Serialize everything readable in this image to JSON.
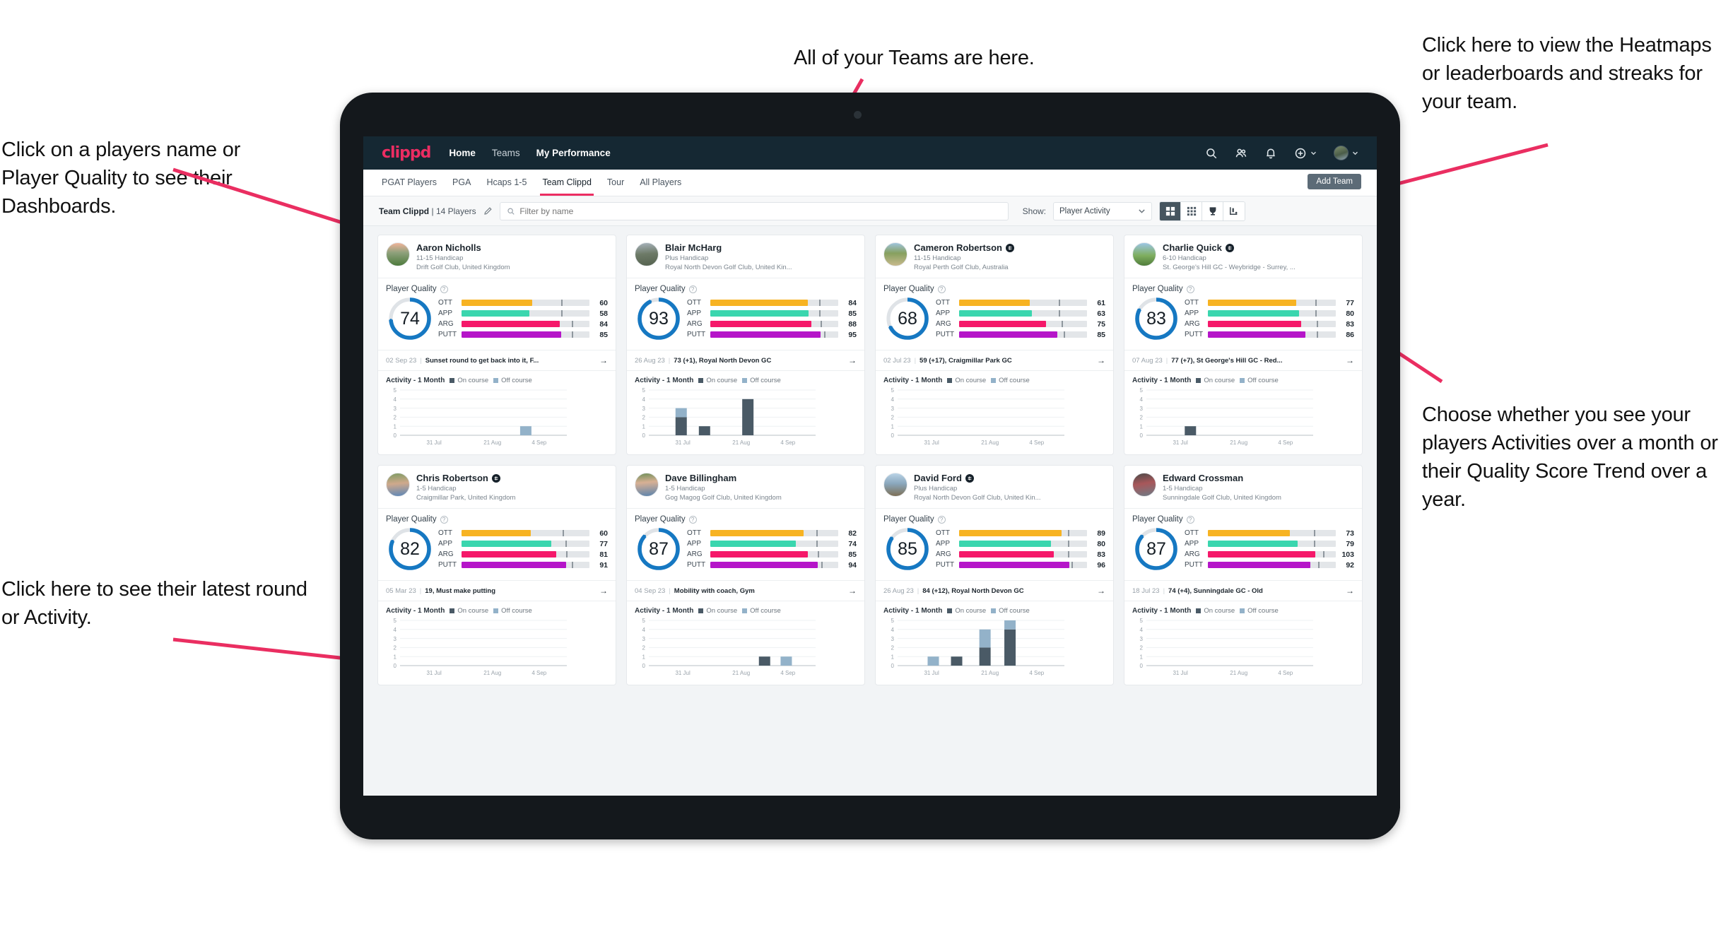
{
  "annotations": {
    "top": "All of your Teams are here.",
    "left_upper": "Click on a players name or Player Quality to see their Dashboards.",
    "left_lower": "Click here to see their latest round or Activity.",
    "right_upper": "Click here to view the Heatmaps or leaderboards and streaks for your team.",
    "right_lower": "Choose whether you see your players Activities over a month or their Quality Score Trend over a year.",
    "arrow_color": "#ea2e61"
  },
  "header": {
    "logo": "clippd",
    "nav": [
      {
        "label": "Home",
        "active": true
      },
      {
        "label": "Teams",
        "active": false
      },
      {
        "label": "My Performance",
        "active": true
      }
    ],
    "icons": [
      {
        "name": "search-icon"
      },
      {
        "name": "people-icon"
      },
      {
        "name": "bell-icon"
      },
      {
        "name": "plus-circle-icon"
      },
      {
        "name": "avatar-icon"
      }
    ],
    "bg": "#152833"
  },
  "subnav": {
    "tabs": [
      {
        "label": "PGAT Players",
        "active": false
      },
      {
        "label": "PGA",
        "active": false
      },
      {
        "label": "Hcaps 1-5",
        "active": false
      },
      {
        "label": "Team Clippd",
        "active": true
      },
      {
        "label": "Tour",
        "active": false
      },
      {
        "label": "All Players",
        "active": false
      }
    ],
    "add_team_label": "Add Team"
  },
  "toolbar": {
    "team_name": "Team Clippd",
    "team_count": "14 Players",
    "separator": "|",
    "edit_icon": "pencil-icon",
    "search_placeholder": "Filter by name",
    "search_value": "",
    "show_label": "Show:",
    "show_value": "Player Activity",
    "show_options": [
      "Player Activity",
      "Quality Score Trend"
    ],
    "views": [
      {
        "name": "grid-large-view-button",
        "icon": "grid-large-icon",
        "active": true
      },
      {
        "name": "grid-small-view-button",
        "icon": "grid-small-icon",
        "active": false
      },
      {
        "name": "leaderboard-view-button",
        "icon": "trophy-icon",
        "active": false
      },
      {
        "name": "heatmap-view-button",
        "icon": "heatmap-icon",
        "active": false
      }
    ]
  },
  "card_labels": {
    "player_quality": "Player Quality",
    "activity": "Activity - 1 Month",
    "legend_on": "On course",
    "legend_off": "Off course",
    "metrics": [
      "OTT",
      "APP",
      "ARG",
      "PUTT"
    ],
    "arrow": "→",
    "help": "?"
  },
  "metric_colors": {
    "OTT": "#f7b322",
    "APP": "#3ad6ae",
    "ARG": "#f5196a",
    "PUTT": "#b515c9",
    "track": "#e3e6e9",
    "ring": "#1678c2",
    "ring_bg": "#dfe3e7",
    "bar_on": "#4a5a66",
    "bar_off": "#93b2c9"
  },
  "players": [
    {
      "name": "Aaron Nicholls",
      "verified": false,
      "handicap": "11-15 Handicap",
      "club": "Drift Golf Club, United Kingdom",
      "quality": 74,
      "metrics": [
        {
          "label": "OTT",
          "value": 60,
          "fill": 55,
          "tick": 78
        },
        {
          "label": "APP",
          "value": 58,
          "fill": 53,
          "tick": 78
        },
        {
          "label": "ARG",
          "value": 84,
          "fill": 77,
          "tick": 86
        },
        {
          "label": "PUTT",
          "value": 85,
          "fill": 78,
          "tick": 86
        }
      ],
      "round": {
        "date": "02 Sep 23",
        "text": "Sunset round to get back into it, F..."
      },
      "chart_data": {
        "type": "bar",
        "ylim": [
          0,
          5
        ],
        "yticks": [
          0,
          1,
          2,
          3,
          4,
          5
        ],
        "xticks": [
          "31 Jul",
          "21 Aug",
          "4 Sep"
        ],
        "bars": [
          {
            "pos": 0.72,
            "on": 0,
            "off": 1
          }
        ]
      }
    },
    {
      "name": "Blair McHarg",
      "verified": false,
      "handicap": "Plus Handicap",
      "club": "Royal North Devon Golf Club, United Kin...",
      "quality": 93,
      "metrics": [
        {
          "label": "OTT",
          "value": 84,
          "fill": 76,
          "tick": 85
        },
        {
          "label": "APP",
          "value": 85,
          "fill": 77,
          "tick": 85
        },
        {
          "label": "ARG",
          "value": 88,
          "fill": 79,
          "tick": 86
        },
        {
          "label": "PUTT",
          "value": 95,
          "fill": 86,
          "tick": 89
        }
      ],
      "round": {
        "date": "26 Aug 23",
        "text": "73 (+1), Royal North Devon GC"
      },
      "chart_data": {
        "type": "bar",
        "ylim": [
          0,
          5
        ],
        "yticks": [
          0,
          1,
          2,
          3,
          4,
          5
        ],
        "xticks": [
          "31 Jul",
          "21 Aug",
          "4 Sep"
        ],
        "bars": [
          {
            "pos": 0.16,
            "on": 2,
            "off": 1
          },
          {
            "pos": 0.3,
            "on": 1,
            "off": 0
          },
          {
            "pos": 0.56,
            "on": 4,
            "off": 0
          }
        ]
      }
    },
    {
      "name": "Cameron Robertson",
      "verified": true,
      "handicap": "11-15 Handicap",
      "club": "Royal Perth Golf Club, Australia",
      "quality": 68,
      "metrics": [
        {
          "label": "OTT",
          "value": 61,
          "fill": 55,
          "tick": 78
        },
        {
          "label": "APP",
          "value": 63,
          "fill": 57,
          "tick": 78
        },
        {
          "label": "ARG",
          "value": 75,
          "fill": 68,
          "tick": 80
        },
        {
          "label": "PUTT",
          "value": 85,
          "fill": 77,
          "tick": 82
        }
      ],
      "round": {
        "date": "02 Jul 23",
        "text": "59 (+17), Craigmillar Park GC"
      },
      "chart_data": {
        "type": "bar",
        "ylim": [
          0,
          5
        ],
        "yticks": [
          0,
          1,
          2,
          3,
          4,
          5
        ],
        "xticks": [
          "31 Jul",
          "21 Aug",
          "4 Sep"
        ],
        "bars": []
      }
    },
    {
      "name": "Charlie Quick",
      "verified": true,
      "handicap": "6-10 Handicap",
      "club": "St. George's Hill GC - Weybridge - Surrey, ...",
      "quality": 83,
      "metrics": [
        {
          "label": "OTT",
          "value": 77,
          "fill": 69,
          "tick": 84
        },
        {
          "label": "APP",
          "value": 80,
          "fill": 71,
          "tick": 84
        },
        {
          "label": "ARG",
          "value": 83,
          "fill": 73,
          "tick": 85
        },
        {
          "label": "PUTT",
          "value": 86,
          "fill": 76,
          "tick": 85
        }
      ],
      "round": {
        "date": "07 Aug 23",
        "text": "77 (+7), St George's Hill GC - Red..."
      },
      "chart_data": {
        "type": "bar",
        "ylim": [
          0,
          5
        ],
        "yticks": [
          0,
          1,
          2,
          3,
          4,
          5
        ],
        "xticks": [
          "31 Jul",
          "21 Aug",
          "4 Sep"
        ],
        "bars": [
          {
            "pos": 0.23,
            "on": 1,
            "off": 0
          }
        ]
      }
    },
    {
      "name": "Chris Robertson",
      "verified": true,
      "handicap": "1-5 Handicap",
      "club": "Craigmillar Park, United Kingdom",
      "quality": 82,
      "metrics": [
        {
          "label": "OTT",
          "value": 60,
          "fill": 54,
          "tick": 79
        },
        {
          "label": "APP",
          "value": 77,
          "fill": 70,
          "tick": 81
        },
        {
          "label": "ARG",
          "value": 81,
          "fill": 74,
          "tick": 82
        },
        {
          "label": "PUTT",
          "value": 91,
          "fill": 82,
          "tick": 86
        }
      ],
      "round": {
        "date": "05 Mar 23",
        "text": "19, Must make putting"
      },
      "chart_data": {
        "type": "bar",
        "ylim": [
          0,
          5
        ],
        "yticks": [
          0,
          1,
          2,
          3,
          4,
          5
        ],
        "xticks": [
          "31 Jul",
          "21 Aug",
          "4 Sep"
        ],
        "bars": []
      }
    },
    {
      "name": "Dave Billingham",
      "verified": false,
      "handicap": "1-5 Handicap",
      "club": "Gog Magog Golf Club, United Kingdom",
      "quality": 87,
      "metrics": [
        {
          "label": "OTT",
          "value": 82,
          "fill": 73,
          "tick": 83
        },
        {
          "label": "APP",
          "value": 74,
          "fill": 67,
          "tick": 83
        },
        {
          "label": "ARG",
          "value": 85,
          "fill": 76,
          "tick": 84
        },
        {
          "label": "PUTT",
          "value": 94,
          "fill": 84,
          "tick": 87
        }
      ],
      "round": {
        "date": "04 Sep 23",
        "text": "Mobility with coach, Gym"
      },
      "chart_data": {
        "type": "bar",
        "ylim": [
          0,
          5
        ],
        "yticks": [
          0,
          1,
          2,
          3,
          4,
          5
        ],
        "xticks": [
          "31 Jul",
          "21 Aug",
          "4 Sep"
        ],
        "bars": [
          {
            "pos": 0.66,
            "on": 1,
            "off": 0
          },
          {
            "pos": 0.79,
            "on": 0,
            "off": 1
          }
        ]
      }
    },
    {
      "name": "David Ford",
      "verified": true,
      "handicap": "Plus Handicap",
      "club": "Royal North Devon Golf Club, United Kin...",
      "quality": 85,
      "metrics": [
        {
          "label": "OTT",
          "value": 89,
          "fill": 80,
          "tick": 85
        },
        {
          "label": "APP",
          "value": 80,
          "fill": 72,
          "tick": 85
        },
        {
          "label": "ARG",
          "value": 83,
          "fill": 74,
          "tick": 85
        },
        {
          "label": "PUTT",
          "value": 96,
          "fill": 86,
          "tick": 88
        }
      ],
      "round": {
        "date": "26 Aug 23",
        "text": "84 (+12), Royal North Devon GC"
      },
      "chart_data": {
        "type": "bar",
        "ylim": [
          0,
          5
        ],
        "yticks": [
          0,
          1,
          2,
          3,
          4,
          5
        ],
        "xticks": [
          "31 Jul",
          "21 Aug",
          "4 Sep"
        ],
        "bars": [
          {
            "pos": 0.18,
            "on": 0,
            "off": 1
          },
          {
            "pos": 0.32,
            "on": 1,
            "off": 0
          },
          {
            "pos": 0.49,
            "on": 2,
            "off": 2
          },
          {
            "pos": 0.64,
            "on": 4,
            "off": 1
          }
        ]
      }
    },
    {
      "name": "Edward Crossman",
      "verified": false,
      "handicap": "1-5 Handicap",
      "club": "Sunningdale Golf Club, United Kingdom",
      "quality": 87,
      "metrics": [
        {
          "label": "OTT",
          "value": 73,
          "fill": 64,
          "tick": 83
        },
        {
          "label": "APP",
          "value": 79,
          "fill": 70,
          "tick": 83
        },
        {
          "label": "ARG",
          "value": 103,
          "fill": 84,
          "tick": 90
        },
        {
          "label": "PUTT",
          "value": 92,
          "fill": 80,
          "tick": 86
        }
      ],
      "round": {
        "date": "18 Jul 23",
        "text": "74 (+4), Sunningdale GC - Old"
      },
      "chart_data": {
        "type": "bar",
        "ylim": [
          0,
          5
        ],
        "yticks": [
          0,
          1,
          2,
          3,
          4,
          5
        ],
        "xticks": [
          "31 Jul",
          "21 Aug",
          "4 Sep"
        ],
        "bars": []
      }
    }
  ]
}
